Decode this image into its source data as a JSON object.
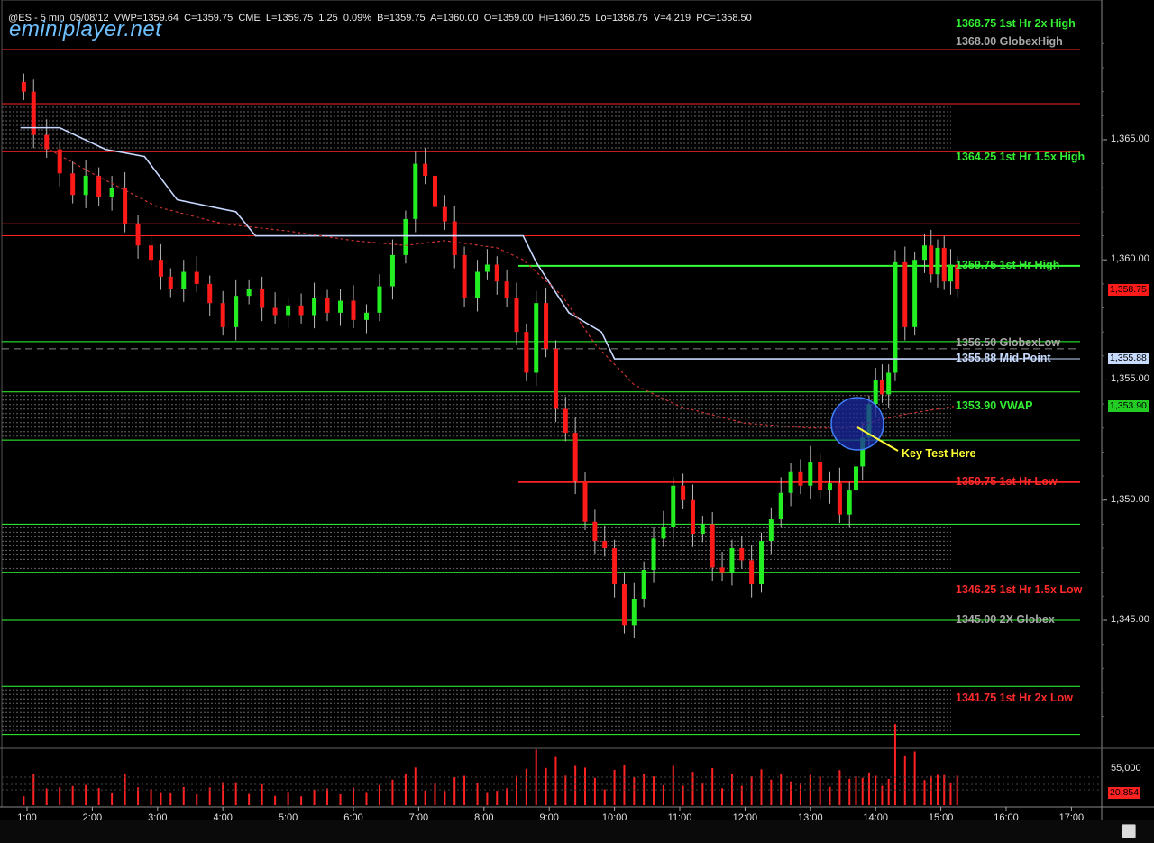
{
  "header": {
    "symbol": "@ES",
    "interval": "5 min",
    "date": "05/08/12",
    "stats": "VWP=1359.64  C=1359.75  CME  L=1359.75  1.25  0.09%  B=1359.75  A=1360.00  O=1359.00  Hi=1360.25  Lo=1358.75  V=4,219  PC=1358.50"
  },
  "brand": "eminiplayer.net",
  "annotation": "Key Test Here",
  "level_labels": [
    {
      "text": "1368.75 1st Hr  2x High",
      "color": "#33ee33",
      "price": 1368.75
    },
    {
      "text": "1368.00 GlobexHigh",
      "color": "#a8a8a8",
      "price": 1368.0
    },
    {
      "text": "1364.25 1st Hr  1.5x High",
      "color": "#33ee33",
      "price": 1364.25
    },
    {
      "text": "1359.75 1st Hr  High",
      "color": "#33ee33",
      "price": 1359.75
    },
    {
      "text": "1356.50 GlobexLow",
      "color": "#a8a8a8",
      "price": 1356.5
    },
    {
      "text": "1355.88 Mid-Point",
      "color": "#c8dcff",
      "price": 1355.88
    },
    {
      "text": "1353.90 VWAP",
      "color": "#33ee33",
      "price": 1353.9
    },
    {
      "text": "1350.75 1st Hr  Low",
      "color": "#ff2a2a",
      "price": 1350.75
    },
    {
      "text": "1346.25 1st Hr  1.5x Low",
      "color": "#ff2a2a",
      "price": 1346.25
    },
    {
      "text": "1345.00 2X Globex",
      "color": "#a8a8a8",
      "price": 1345.0
    },
    {
      "text": "1341.75 1st Hr  2x Low",
      "color": "#ff2a2a",
      "price": 1341.75
    }
  ],
  "price_tags": [
    {
      "text": "1,358.75",
      "price": 1358.75,
      "bg": "#ff1a1a",
      "fg": "#000000"
    },
    {
      "text": "1,355.88",
      "price": 1355.88,
      "bg": "#c8dcff",
      "fg": "#000000"
    },
    {
      "text": "1,353.90",
      "price": 1353.9,
      "bg": "#22cc22",
      "fg": "#000000"
    }
  ],
  "volume_axis": [
    "55,000"
  ],
  "volume_tag": {
    "text": "20,854",
    "value": 20854
  },
  "colors": {
    "up": "#22ee22",
    "down": "#ff1a1a",
    "background": "#000000",
    "grid": "#2a2a2a",
    "midpoint_line": "#c8d8ff",
    "vwap": "#cc3333",
    "volume": "#ff2222"
  },
  "chart_data": {
    "type": "candlestick",
    "title": "",
    "x_axis": {
      "type": "time",
      "tick_labels": [
        "1:00",
        "2:00",
        "3:00",
        "4:00",
        "5:00",
        "6:00",
        "7:00",
        "8:00",
        "9:00",
        "10:00",
        "11:00",
        "12:00",
        "13:00",
        "14:00",
        "15:00",
        "16:00",
        "17:00"
      ]
    },
    "y_axis": {
      "range": [
        1339.5,
        1370
      ],
      "tick_labels": [
        "1,345.00",
        "1,350.00",
        "1,355.00",
        "1,360.00",
        "1,365.00"
      ]
    },
    "grid": false,
    "levels": [
      {
        "price": 1368.75,
        "color": "#ff2222",
        "style": "solid"
      },
      {
        "price": 1366.5,
        "color": "#ff2222",
        "style": "solid"
      },
      {
        "price": 1364.5,
        "color": "#ff2222",
        "style": "solid"
      },
      {
        "price": 1361.5,
        "color": "#ff2222",
        "style": "solid"
      },
      {
        "price": 1361.0,
        "color": "#ff2222",
        "style": "solid"
      },
      {
        "price": 1359.75,
        "color": "#33ff33",
        "style": "solid"
      },
      {
        "price": 1356.6,
        "color": "#33ff33",
        "style": "solid"
      },
      {
        "price": 1356.3,
        "color": "#888888",
        "style": "dashed"
      },
      {
        "price": 1355.88,
        "color": "#c8d8ff",
        "style": "solid"
      },
      {
        "price": 1354.5,
        "color": "#33ff33",
        "style": "solid"
      },
      {
        "price": 1352.5,
        "color": "#33ff33",
        "style": "solid"
      },
      {
        "price": 1350.75,
        "color": "#ff2222",
        "style": "solid"
      },
      {
        "price": 1349.0,
        "color": "#33ff33",
        "style": "solid"
      },
      {
        "price": 1347.0,
        "color": "#33ff33",
        "style": "solid"
      },
      {
        "price": 1345.0,
        "color": "#33ff33",
        "style": "solid"
      },
      {
        "price": 1342.25,
        "color": "#33ff33",
        "style": "solid"
      },
      {
        "price": 1340.25,
        "color": "#33ff33",
        "style": "solid"
      }
    ],
    "zones": [
      [
        1364.5,
        1366.5
      ],
      [
        1352.5,
        1354.5
      ],
      [
        1347.0,
        1349.0
      ],
      [
        1340.25,
        1342.25
      ]
    ],
    "vwap_price": 1353.9,
    "volume_scale": [
      0,
      61000
    ]
  }
}
